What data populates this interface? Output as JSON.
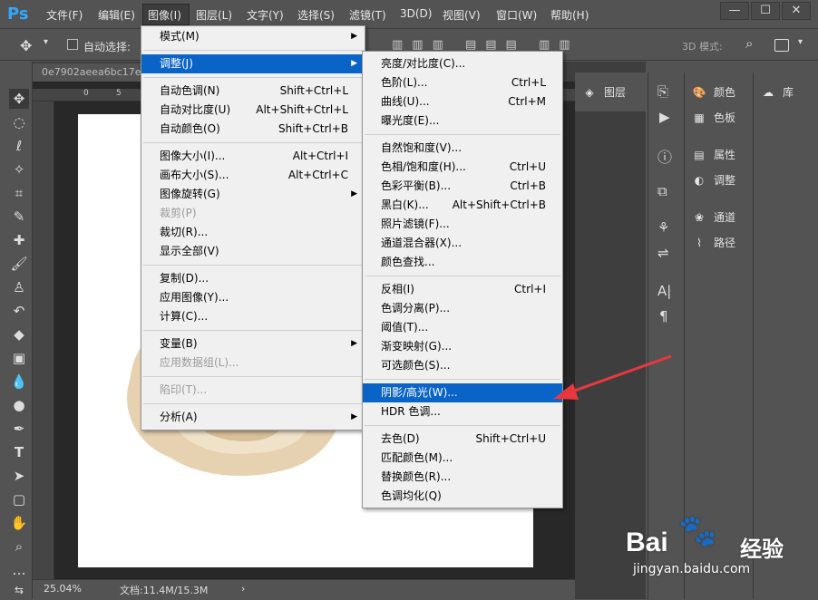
{
  "app": {
    "logo": "Ps"
  },
  "menubar": {
    "items": [
      "文件(F)",
      "编辑(E)",
      "图像(I)",
      "图层(L)",
      "文字(Y)",
      "选择(S)",
      "滤镜(T)",
      "3D(D)",
      "视图(V)",
      "窗口(W)",
      "帮助(H)"
    ],
    "window_buttons": [
      "—",
      "☐",
      "✕"
    ]
  },
  "options": {
    "auto_select": "自动选择:",
    "mode_3d": "3D 模式:"
  },
  "document": {
    "tab": "0e7902aeea6bc17e8",
    "zoom": "25.04%",
    "doc_size": "文档:11.4M/15.3M",
    "ruler_marks": [
      "0",
      "5"
    ]
  },
  "image_menu": {
    "items": [
      {
        "label": "模式(M)",
        "shortcut": "",
        "submenu": true
      },
      {
        "sep": true
      },
      {
        "label": "调整(J)",
        "shortcut": "",
        "submenu": true,
        "highlight": true
      },
      {
        "sep": true
      },
      {
        "label": "自动色调(N)",
        "shortcut": "Shift+Ctrl+L"
      },
      {
        "label": "自动对比度(U)",
        "shortcut": "Alt+Shift+Ctrl+L"
      },
      {
        "label": "自动颜色(O)",
        "shortcut": "Shift+Ctrl+B"
      },
      {
        "sep": true
      },
      {
        "label": "图像大小(I)...",
        "shortcut": "Alt+Ctrl+I"
      },
      {
        "label": "画布大小(S)...",
        "shortcut": "Alt+Ctrl+C"
      },
      {
        "label": "图像旋转(G)",
        "shortcut": "",
        "submenu": true
      },
      {
        "label": "裁剪(P)",
        "shortcut": "",
        "disabled": true
      },
      {
        "label": "裁切(R)...",
        "shortcut": ""
      },
      {
        "label": "显示全部(V)",
        "shortcut": ""
      },
      {
        "sep": true
      },
      {
        "label": "复制(D)...",
        "shortcut": ""
      },
      {
        "label": "应用图像(Y)...",
        "shortcut": ""
      },
      {
        "label": "计算(C)...",
        "shortcut": ""
      },
      {
        "sep": true
      },
      {
        "label": "变量(B)",
        "shortcut": "",
        "submenu": true
      },
      {
        "label": "应用数据组(L)...",
        "shortcut": "",
        "disabled": true
      },
      {
        "sep": true
      },
      {
        "label": "陷印(T)...",
        "shortcut": "",
        "disabled": true
      },
      {
        "sep": true
      },
      {
        "label": "分析(A)",
        "shortcut": "",
        "submenu": true
      }
    ]
  },
  "adjust_menu": {
    "items": [
      {
        "label": "亮度/对比度(C)...",
        "shortcut": ""
      },
      {
        "label": "色阶(L)...",
        "shortcut": "Ctrl+L"
      },
      {
        "label": "曲线(U)...",
        "shortcut": "Ctrl+M"
      },
      {
        "label": "曝光度(E)...",
        "shortcut": ""
      },
      {
        "sep": true
      },
      {
        "label": "自然饱和度(V)...",
        "shortcut": ""
      },
      {
        "label": "色相/饱和度(H)...",
        "shortcut": "Ctrl+U"
      },
      {
        "label": "色彩平衡(B)...",
        "shortcut": "Ctrl+B"
      },
      {
        "label": "黑白(K)...",
        "shortcut": "Alt+Shift+Ctrl+B"
      },
      {
        "label": "照片滤镜(F)...",
        "shortcut": ""
      },
      {
        "label": "通道混合器(X)...",
        "shortcut": ""
      },
      {
        "label": "颜色查找...",
        "shortcut": ""
      },
      {
        "sep": true
      },
      {
        "label": "反相(I)",
        "shortcut": "Ctrl+I"
      },
      {
        "label": "色调分离(P)...",
        "shortcut": ""
      },
      {
        "label": "阈值(T)...",
        "shortcut": ""
      },
      {
        "label": "渐变映射(G)...",
        "shortcut": ""
      },
      {
        "label": "可选颜色(S)...",
        "shortcut": ""
      },
      {
        "sep": true
      },
      {
        "label": "阴影/高光(W)...",
        "shortcut": "",
        "highlight": true
      },
      {
        "label": "HDR 色调...",
        "shortcut": ""
      },
      {
        "sep": true
      },
      {
        "label": "去色(D)",
        "shortcut": "Shift+Ctrl+U"
      },
      {
        "label": "匹配颜色(M)...",
        "shortcut": ""
      },
      {
        "label": "替换颜色(R)...",
        "shortcut": ""
      },
      {
        "label": "色调均化(Q)",
        "shortcut": ""
      }
    ]
  },
  "panels": {
    "layers": "图层",
    "color": "颜色",
    "swatches": "色板",
    "properties": "属性",
    "adjustments": "调整",
    "channels": "通道",
    "paths": "路径",
    "libraries": "库"
  },
  "watermark": {
    "brand": "Bai",
    "brand2": "经验",
    "url": "jingyan.baidu.com"
  },
  "colors": {
    "highlight": "#0a64c8",
    "menu_bg": "#f0f0f0",
    "ui_dark": "#535353",
    "arrow": "#e8383d"
  }
}
